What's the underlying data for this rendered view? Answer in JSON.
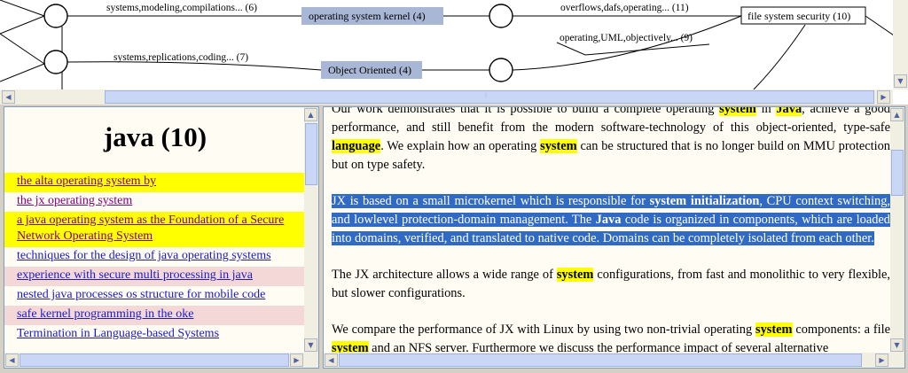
{
  "graph": {
    "edge_labels": {
      "e1": "systems,modeling,compilations... (6)",
      "e2": "systems,replications,coding... (7)",
      "e3": "overflows,dafs,operating... (11)",
      "e4": "operating,UML,objectively... (9)"
    },
    "clusters": {
      "c1": "operating system kernel (4)",
      "c2": "Object Oriented (4)",
      "c3": "file system security (10)"
    },
    "colors": {
      "cluster_fill": "#a9b7d6",
      "highlight": "#ffff00",
      "selection": "#316ac5"
    }
  },
  "left": {
    "title": "java (10)",
    "documents": [
      {
        "label": "the alta operating system by",
        "style": "hl-yellow"
      },
      {
        "label": "the jx operating system",
        "style": "plain-visited"
      },
      {
        "label": "a java operating system as the Foundation of a Secure Network Operating System",
        "style": "hl-yellow"
      },
      {
        "label": "techniques for the design of java operating systems",
        "style": "plain"
      },
      {
        "label": "experience with secure multi processing in java",
        "style": "hl-pink"
      },
      {
        "label": "nested java processes os structure for mobile code",
        "style": "plain"
      },
      {
        "label": "safe kernel programming in the oke",
        "style": "hl-pink"
      },
      {
        "label": "Termination in Language-based Systems",
        "style": "plain"
      }
    ]
  },
  "right": {
    "p1": {
      "t1": "Our work demonstrates that it is possible to build a complete operating ",
      "k1": "system",
      "t2": " in ",
      "k2": "Java",
      "t3": ", achieve a good performance, and still benefit from the modern software-technology of this object-oriented, type-safe ",
      "k3": "language",
      "t4": ". We explain how an operating ",
      "k4": "system",
      "t5": " can be structured that is no longer build on MMU protection but on type safety."
    },
    "p2": {
      "t1": "JX is based on a small microkernel which is responsible for ",
      "b1": "system initialization",
      "t2": ", CPU context switching, and lowlevel protection-domain management. The ",
      "b2": "Java",
      "t3": " code is organized in components, which are loaded into domains, verified, and translated to native code. Domains can be completely isolated from each other."
    },
    "p3": {
      "t1": "The JX architecture allows a wide range of ",
      "k1": "system",
      "t2": " configurations, from fast and monolithic to very flexible, but slower configurations."
    },
    "p4": {
      "t1": "We compare the performance of JX with Linux by using two non-trivial operating ",
      "k1": "system",
      "t2": " components: a file ",
      "k2": "system",
      "t3": " and an NFS server. Furthermore we discuss the performance impact of several alternative"
    }
  }
}
